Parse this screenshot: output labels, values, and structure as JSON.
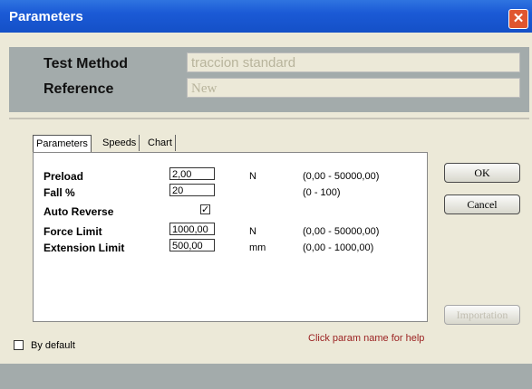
{
  "window": {
    "title": "Parameters",
    "close_glyph": "✕"
  },
  "header": {
    "test_method_label": "Test Method",
    "test_method_value": "traccion standard",
    "reference_label": "Reference",
    "reference_value": "New"
  },
  "tabs": [
    {
      "label": "Parameters",
      "active": true
    },
    {
      "label": "Speeds",
      "active": false
    },
    {
      "label": "Chart",
      "active": false
    }
  ],
  "params": {
    "preload": {
      "label": "Preload",
      "value": "2,00",
      "unit": "N",
      "range": "(0,00 - 50000,00)"
    },
    "fall": {
      "label": "Fall %",
      "value": "20",
      "unit": "",
      "range": "(0 - 100)"
    },
    "auto_reverse": {
      "label": "Auto Reverse",
      "checked": true,
      "check_glyph": "✓"
    },
    "force_limit": {
      "label": "Force Limit",
      "value": "1000,00",
      "unit": "N",
      "range": "(0,00 - 50000,00)"
    },
    "extension_limit": {
      "label": "Extension Limit",
      "value": "500,00",
      "unit": "mm",
      "range": "(0,00 - 1000,00)"
    }
  },
  "buttons": {
    "ok": "OK",
    "cancel": "Cancel",
    "importation": "Importation"
  },
  "help_text": "Click param name for help",
  "by_default": {
    "label": "By default",
    "checked": false
  },
  "colors": {
    "titlebar": "#1b5ad6",
    "panel": "#a3abab",
    "dialog": "#ece9d8",
    "help": "#9a1f1f"
  }
}
